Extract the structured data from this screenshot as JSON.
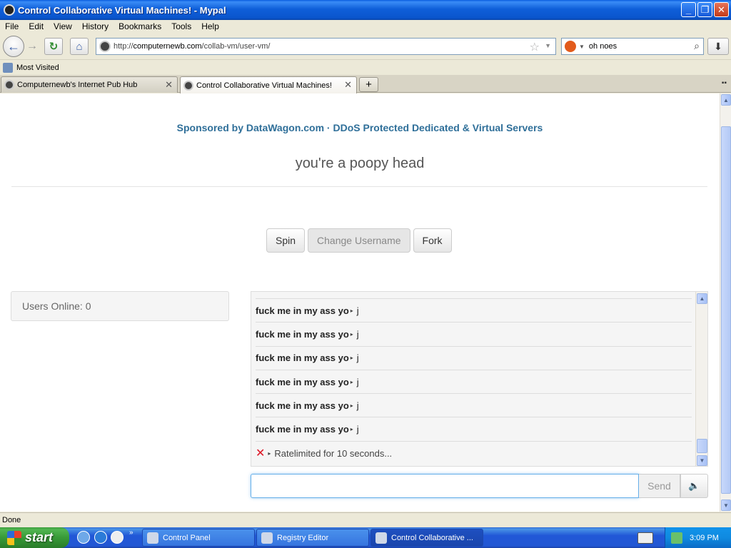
{
  "window": {
    "title": "Control Collaborative Virtual Machines! - Mypal"
  },
  "menu": [
    "File",
    "Edit",
    "View",
    "History",
    "Bookmarks",
    "Tools",
    "Help"
  ],
  "nav": {
    "url_prefix": "http://",
    "url_host": "computernewb.com",
    "url_path": "/collab-vm/user-vm/",
    "search_value": "oh noes"
  },
  "bookmarks": {
    "most_visited": "Most Visited"
  },
  "tabs": [
    {
      "label": "Computernewb's Internet Pub Hub",
      "active": false
    },
    {
      "label": "Control Collaborative Virtual Machines!",
      "active": true
    }
  ],
  "page": {
    "sponsor": "Sponsored by DataWagon.com · DDoS Protected Dedicated & Virtual Servers",
    "headline": "you're a poopy head",
    "buttons": {
      "spin": "Spin",
      "change_username": "Change Username",
      "fork": "Fork"
    },
    "users_online": "Users Online: 0",
    "chat": [
      {
        "user": "fuck me in my ass yo",
        "msg": "j"
      },
      {
        "user": "fuck me in my ass yo",
        "msg": "j"
      },
      {
        "user": "fuck me in my ass yo",
        "msg": "j"
      },
      {
        "user": "fuck me in my ass yo",
        "msg": "j"
      },
      {
        "user": "fuck me in my ass yo",
        "msg": "j"
      },
      {
        "user": "fuck me in my ass yo",
        "msg": "j"
      }
    ],
    "chat_error": "Ratelimited for 10 seconds...",
    "chat_input_value": "",
    "send_label": "Send"
  },
  "status": {
    "text": "Done"
  },
  "taskbar": {
    "start_label": "start",
    "tasks": [
      {
        "label": "Control Panel",
        "active": false
      },
      {
        "label": "Registry Editor",
        "active": false
      },
      {
        "label": "Control Collaborative ...",
        "active": true
      }
    ],
    "clock": "3:09 PM"
  }
}
